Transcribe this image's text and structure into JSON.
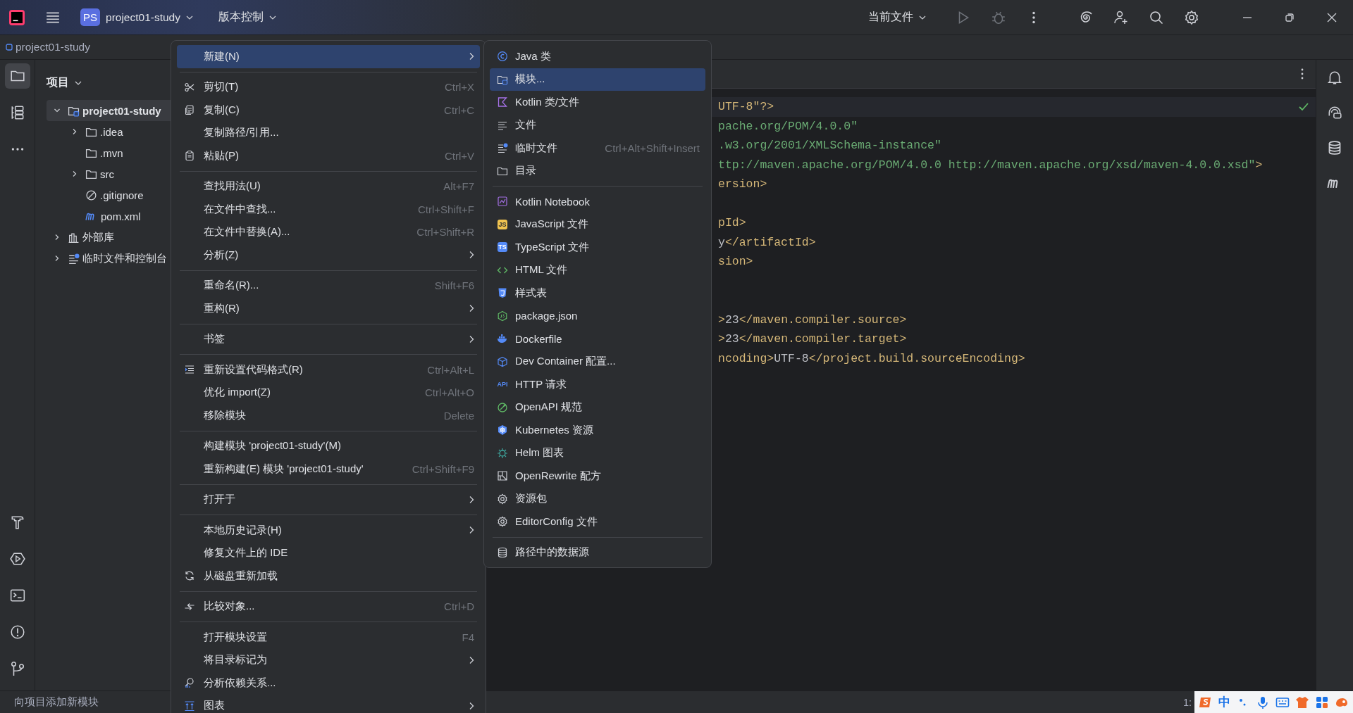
{
  "title_bar": {
    "project_badge": "PS",
    "project_name": "project01-study",
    "vcs_menu": "版本控制",
    "run_config": "当前文件"
  },
  "breadcrumb": "project01-study",
  "project_panel": {
    "title": "项目",
    "tree": [
      {
        "label": "project01-study",
        "kind": "module",
        "expanded": true,
        "selected": true,
        "children": [
          {
            "label": ".idea",
            "kind": "folder",
            "expanded": false
          },
          {
            "label": ".mvn",
            "kind": "folder"
          },
          {
            "label": "src",
            "kind": "folder",
            "expanded": false
          },
          {
            "label": ".gitignore",
            "kind": "ignore"
          },
          {
            "label": "pom.xml",
            "kind": "maven"
          }
        ]
      },
      {
        "label": "外部库",
        "kind": "library",
        "expanded": false
      },
      {
        "label": "临时文件和控制台",
        "kind": "scratch",
        "expanded": false
      }
    ]
  },
  "code_lines": [
    {
      "kind": "code",
      "current": true,
      "segments": [
        {
          "kind": "tag",
          "text": "UTF-8\"?>"
        }
      ]
    },
    {
      "kind": "code",
      "current": false,
      "segments": [
        {
          "kind": "string",
          "text": "pache.org/POM/4.0.0\""
        }
      ]
    },
    {
      "kind": "code",
      "current": false,
      "segments": [
        {
          "kind": "string",
          "text": ".w3.org/2001/XMLSchema-instance\""
        }
      ]
    },
    {
      "kind": "code",
      "current": false,
      "segments": [
        {
          "kind": "string",
          "text": "ttp://maven.apache.org/POM/4.0.0 http://maven.apache.org/xsd/maven-4.0.0.xsd\""
        },
        {
          "kind": "tag",
          "text": ">"
        }
      ]
    },
    {
      "kind": "code",
      "current": false,
      "segments": [
        {
          "kind": "tag",
          "text": "ersion>"
        }
      ]
    },
    {
      "kind": "blank",
      "current": false
    },
    {
      "kind": "code",
      "current": false,
      "segments": [
        {
          "kind": "tag",
          "text": "pId>"
        }
      ]
    },
    {
      "kind": "code",
      "current": false,
      "segments": [
        {
          "kind": "text",
          "text": "y"
        },
        {
          "kind": "tag",
          "text": "</artifactId>"
        }
      ]
    },
    {
      "kind": "code",
      "current": false,
      "segments": [
        {
          "kind": "tag",
          "text": "sion>"
        }
      ]
    },
    {
      "kind": "blank",
      "current": false
    },
    {
      "kind": "blank",
      "current": false
    },
    {
      "kind": "code",
      "current": false,
      "segments": [
        {
          "kind": "tag",
          "text": ">"
        },
        {
          "kind": "text",
          "text": "23"
        },
        {
          "kind": "tag",
          "text": "</maven.compiler.source>"
        }
      ]
    },
    {
      "kind": "code",
      "current": false,
      "segments": [
        {
          "kind": "tag",
          "text": ">"
        },
        {
          "kind": "text",
          "text": "23"
        },
        {
          "kind": "tag",
          "text": "</maven.compiler.target>"
        }
      ]
    },
    {
      "kind": "code",
      "current": false,
      "segments": [
        {
          "kind": "tag",
          "text": "ncoding>"
        },
        {
          "kind": "text",
          "text": "UTF-8"
        },
        {
          "kind": "tag",
          "text": "</project.build.sourceEncoding>"
        }
      ]
    }
  ],
  "context_menu": [
    {
      "kind": "item",
      "label": "新建(N)",
      "submenu": true,
      "selected": true
    },
    {
      "kind": "separator"
    },
    {
      "kind": "item",
      "label": "剪切(T)",
      "shortcut": "Ctrl+X",
      "submenu": false,
      "selected": false
    },
    {
      "kind": "item",
      "label": "复制(C)",
      "shortcut": "Ctrl+C",
      "submenu": false,
      "selected": false
    },
    {
      "kind": "item",
      "label": "复制路径/引用...",
      "submenu": false,
      "selected": false
    },
    {
      "kind": "item",
      "label": "粘贴(P)",
      "shortcut": "Ctrl+V",
      "submenu": false,
      "selected": false
    },
    {
      "kind": "separator"
    },
    {
      "kind": "item",
      "label": "查找用法(U)",
      "shortcut": "Alt+F7",
      "submenu": false,
      "selected": false
    },
    {
      "kind": "item",
      "label": "在文件中查找...",
      "shortcut": "Ctrl+Shift+F",
      "submenu": false,
      "selected": false
    },
    {
      "kind": "item",
      "label": "在文件中替换(A)...",
      "shortcut": "Ctrl+Shift+R",
      "submenu": false,
      "selected": false
    },
    {
      "kind": "item",
      "label": "分析(Z)",
      "submenu": true,
      "selected": false
    },
    {
      "kind": "separator"
    },
    {
      "kind": "item",
      "label": "重命名(R)...",
      "shortcut": "Shift+F6",
      "submenu": false,
      "selected": false
    },
    {
      "kind": "item",
      "label": "重构(R)",
      "submenu": true,
      "selected": false
    },
    {
      "kind": "separator"
    },
    {
      "kind": "item",
      "label": "书签",
      "submenu": true,
      "selected": false
    },
    {
      "kind": "separator"
    },
    {
      "kind": "item",
      "label": "重新设置代码格式(R)",
      "shortcut": "Ctrl+Alt+L",
      "submenu": false,
      "selected": false
    },
    {
      "kind": "item",
      "label": "优化 import(Z)",
      "shortcut": "Ctrl+Alt+O",
      "submenu": false,
      "selected": false
    },
    {
      "kind": "item",
      "label": "移除模块",
      "shortcut": "Delete",
      "submenu": false,
      "selected": false
    },
    {
      "kind": "separator"
    },
    {
      "kind": "item",
      "label": "构建模块 'project01-study'(M)",
      "submenu": false,
      "selected": false
    },
    {
      "kind": "item",
      "label": "重新构建(E) 模块 'project01-study'",
      "shortcut": "Ctrl+Shift+F9",
      "submenu": false,
      "selected": false
    },
    {
      "kind": "separator"
    },
    {
      "kind": "item",
      "label": "打开于",
      "submenu": true,
      "selected": false
    },
    {
      "kind": "separator"
    },
    {
      "kind": "item",
      "label": "本地历史记录(H)",
      "submenu": true,
      "selected": false
    },
    {
      "kind": "item",
      "label": "修复文件上的 IDE",
      "submenu": false,
      "selected": false
    },
    {
      "kind": "item",
      "label": "从磁盘重新加载",
      "submenu": false,
      "selected": false
    },
    {
      "kind": "separator"
    },
    {
      "kind": "item",
      "label": "比较对象...",
      "shortcut": "Ctrl+D",
      "submenu": false,
      "selected": false
    },
    {
      "kind": "separator"
    },
    {
      "kind": "item",
      "label": "打开模块设置",
      "shortcut": "F4",
      "submenu": false,
      "selected": false
    },
    {
      "kind": "item",
      "label": "将目录标记为",
      "submenu": true,
      "selected": false
    },
    {
      "kind": "item",
      "label": "分析依赖关系...",
      "submenu": false,
      "selected": false
    },
    {
      "kind": "item",
      "label": "图表",
      "submenu": true,
      "selected": false
    }
  ],
  "new_submenu": [
    {
      "kind": "item",
      "label": "Java 类",
      "selected": false
    },
    {
      "kind": "item",
      "label": "模块...",
      "selected": true
    },
    {
      "kind": "item",
      "label": "Kotlin 类/文件",
      "selected": false
    },
    {
      "kind": "item",
      "label": "文件",
      "selected": false
    },
    {
      "kind": "item",
      "label": "临时文件",
      "shortcut": "Ctrl+Alt+Shift+Insert",
      "selected": false
    },
    {
      "kind": "item",
      "label": "目录",
      "selected": false
    },
    {
      "kind": "separator"
    },
    {
      "kind": "item",
      "label": "Kotlin Notebook",
      "selected": false
    },
    {
      "kind": "item",
      "label": "JavaScript 文件",
      "icon_text": "JS",
      "selected": false
    },
    {
      "kind": "item",
      "label": "TypeScript 文件",
      "icon_text": "TS",
      "selected": false
    },
    {
      "kind": "item",
      "label": "HTML 文件",
      "selected": false
    },
    {
      "kind": "item",
      "label": "样式表",
      "selected": false
    },
    {
      "kind": "item",
      "label": "package.json",
      "selected": false
    },
    {
      "kind": "item",
      "label": "Dockerfile",
      "selected": false
    },
    {
      "kind": "item",
      "label": "Dev Container 配置...",
      "selected": false
    },
    {
      "kind": "item",
      "label": "HTTP 请求",
      "icon_text": "API",
      "selected": false
    },
    {
      "kind": "item",
      "label": "OpenAPI 规范",
      "selected": false
    },
    {
      "kind": "item",
      "label": "Kubernetes 资源",
      "selected": false
    },
    {
      "kind": "item",
      "label": "Helm 图表",
      "selected": false
    },
    {
      "kind": "item",
      "label": "OpenRewrite 配方",
      "selected": false
    },
    {
      "kind": "item",
      "label": "资源包",
      "selected": false
    },
    {
      "kind": "item",
      "label": "EditorConfig 文件",
      "selected": false
    },
    {
      "kind": "separator"
    },
    {
      "kind": "item",
      "label": "路径中的数据源",
      "selected": false
    }
  ],
  "status_bar": {
    "message": "向项目添加新模块",
    "position": "1:",
    "ime_mode": "中"
  }
}
